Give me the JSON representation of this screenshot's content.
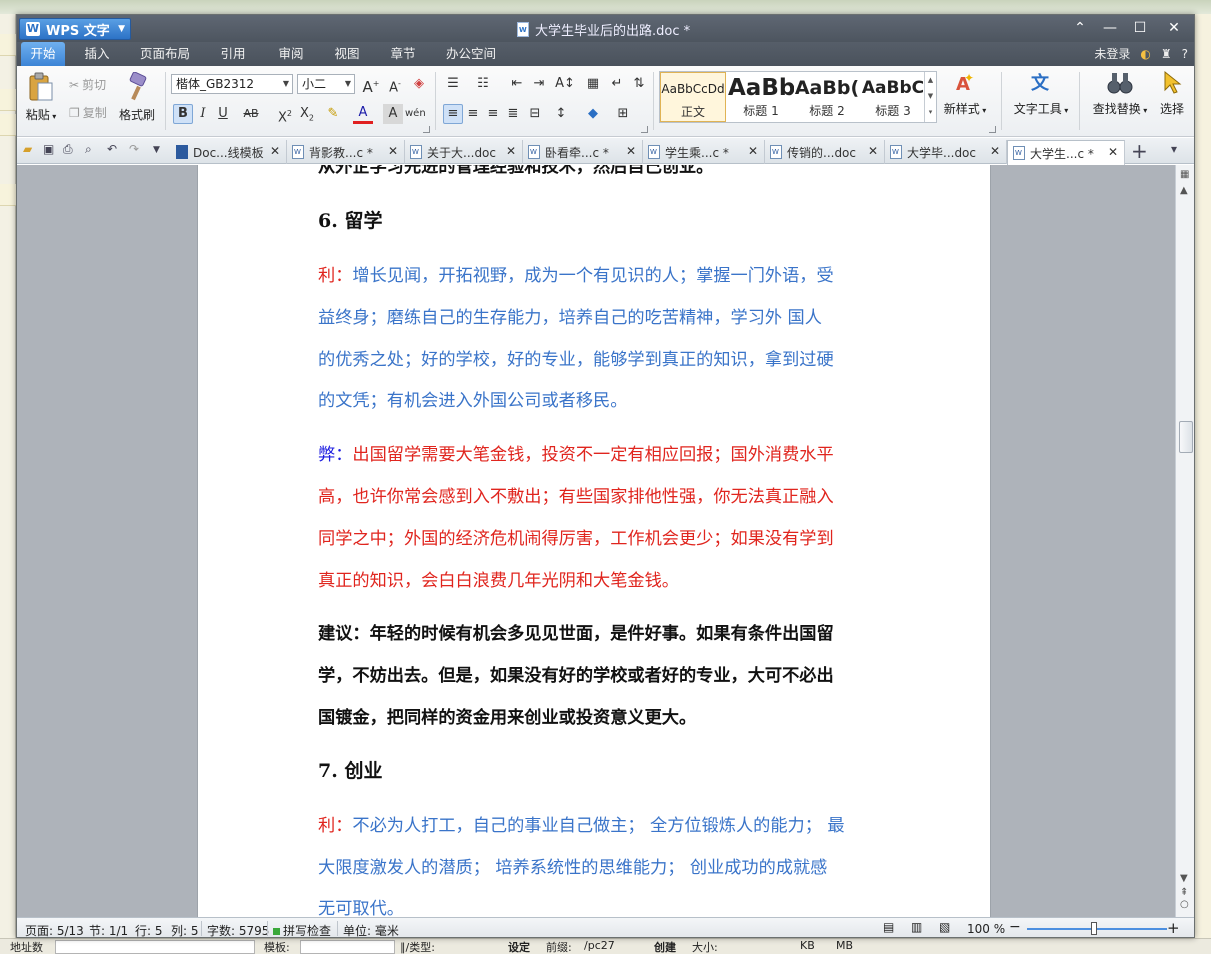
{
  "window": {
    "app_name": "WPS 文字",
    "doc_title": "大学生毕业后的出路.doc *",
    "minimize": "—",
    "maximize": "☐",
    "close": "✕",
    "restore": "⌃"
  },
  "menu": {
    "items": [
      "开始",
      "插入",
      "页面布局",
      "引用",
      "审阅",
      "视图",
      "章节",
      "办公空间"
    ],
    "login": "未登录",
    "help": "?"
  },
  "ribbon": {
    "paste": "粘贴",
    "cut": "剪切",
    "copy": "复制",
    "format_painter": "格式刷",
    "font_name": "楷体_GB2312",
    "font_size": "小二",
    "styles": [
      {
        "sample": "AaBbCcDd",
        "name": "正文"
      },
      {
        "sample": "AaBb",
        "name": "标题 1"
      },
      {
        "sample": "AaBb(",
        "name": "标题 2"
      },
      {
        "sample": "AaBbC",
        "name": "标题 3"
      }
    ],
    "new_style": "新样式",
    "text_tools": "文字工具",
    "find_replace": "查找替换",
    "select": "选择"
  },
  "tabs": [
    {
      "label": "Doc...线模板"
    },
    {
      "label": "背影教...c *"
    },
    {
      "label": "关于大...doc"
    },
    {
      "label": "卧看牵...c *"
    },
    {
      "label": "学生乘...c *"
    },
    {
      "label": "传销的...doc"
    },
    {
      "label": "大学毕...doc"
    },
    {
      "label": "大学生...c *"
    }
  ],
  "document": {
    "top_cut_line": "从外企学习先进的管理经验和技术，然后自己创业。",
    "h6": "6. 留学",
    "adv_label": "利：",
    "adv_lines": [
      "增长见闻，开拓视野，成为一个有见识的人；掌握一门外语，受",
      "益终身；磨练自己的生存能力，培养自己的吃苦精神，学习外 国人",
      "的优秀之处；好的学校，好的专业，能够学到真正的知识，拿到过硬",
      "的文凭；有机会进入外国公司或者移民。"
    ],
    "dis_label": "弊：",
    "dis_lines": [
      "出国留学需要大笔金钱，投资不一定有相应回报；国外消费水平",
      "高，也许你常会感到入不敷出；有些国家排他性强，你无法真正融入",
      "同学之中；外国的经济危机闹得厉害，工作机会更少；如果没有学到",
      "真正的知识，会白白浪费几年光阴和大笔金钱。"
    ],
    "sugg_lines": [
      "建议：年轻的时候有机会多见见世面，是件好事。如果有条件出国留",
      "学，不妨出去。但是，如果没有好的学校或者好的专业，大可不必出",
      "国镀金，把同样的资金用来创业或投资意义更大。"
    ],
    "h7": "7. 创业",
    "adv2_label": "利：",
    "adv2_lines": [
      "不必为人打工，自己的事业自己做主；  全方位锻炼人的能力；  最",
      "大限度激发人的潜质；  培养系统性的思维能力；  创业成功的成就感",
      "无可取代。"
    ]
  },
  "status": {
    "page": "页面: 5/13",
    "section": "节: 1/1",
    "row": "行: 5",
    "col": "列: 5",
    "words": "字数: 5795",
    "spell": "拼写检查",
    "unit": "单位: 毫米",
    "zoom": "100 %"
  },
  "background": {
    "bottom_labels": [
      "地址数",
      "模板:",
      "∥/类型:",
      "设定",
      "前缀:",
      "/pc27",
      "创建",
      "大小:",
      "KB",
      "MB"
    ]
  },
  "colors": {
    "adv_text": "#3a74c9",
    "dis_text": "#e0251e",
    "label_red": "#e0251e",
    "label_blue": "#1c1ce0",
    "accent": "#3c84d6"
  }
}
